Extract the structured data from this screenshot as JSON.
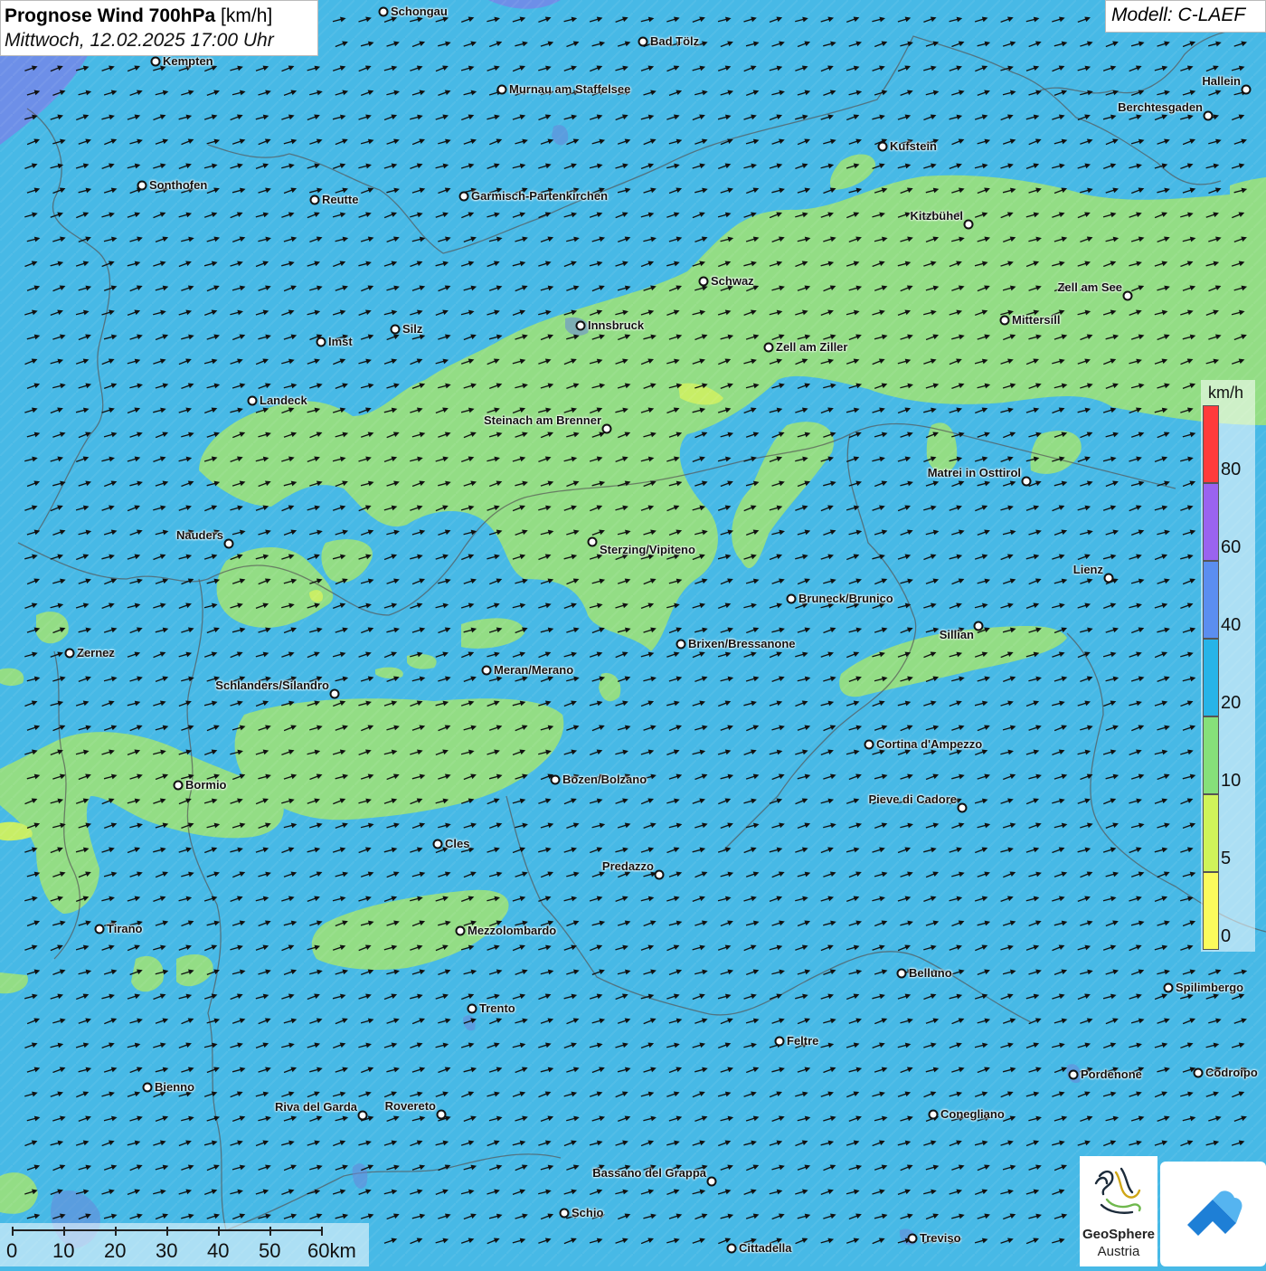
{
  "header": {
    "title_bold": "Prognose Wind 700hPa",
    "title_unit": "[km/h]",
    "datetime": "Mittwoch, 12.02.2025 17:00 Uhr"
  },
  "model": {
    "label": "Modell: C-LAEF"
  },
  "legend": {
    "unit": "km/h",
    "ticks": [
      "80",
      "60",
      "40",
      "20",
      "10",
      "5",
      "0"
    ],
    "colors": [
      "#ff3b3b",
      "#9a63ef",
      "#5b8ef0",
      "#27b4e8",
      "#86e07a",
      "#d0f45a",
      "#fbfb5c"
    ]
  },
  "scalebar": {
    "labels": [
      "0",
      "10",
      "20",
      "30",
      "40",
      "50",
      "60km"
    ]
  },
  "colors": {
    "wind_10_20": "#93dd85",
    "wind_20_40": "#47b9e6",
    "wind_5_10": "#c8ee66"
  },
  "wind": {
    "direction": "from west-southwest towards east-northeast"
  },
  "cities": [
    {
      "name": "Schongau"
    },
    {
      "name": "Bad Tölz"
    },
    {
      "name": "Kempten"
    },
    {
      "name": "Murnau am Staffelsee"
    },
    {
      "name": "Hallein"
    },
    {
      "name": "Berchtesgaden"
    },
    {
      "name": "Kufstein"
    },
    {
      "name": "Sonthofen"
    },
    {
      "name": "Reutte"
    },
    {
      "name": "Garmisch-Partenkirchen"
    },
    {
      "name": "Kitzbühel"
    },
    {
      "name": "Schwaz"
    },
    {
      "name": "Zell am See"
    },
    {
      "name": "Innsbruck"
    },
    {
      "name": "Mittersill"
    },
    {
      "name": "Silz"
    },
    {
      "name": "Imst"
    },
    {
      "name": "Zell am Ziller"
    },
    {
      "name": "Landeck"
    },
    {
      "name": "Steinach am Brenner"
    },
    {
      "name": "Matrei in Osttirol"
    },
    {
      "name": "Nauders"
    },
    {
      "name": "Sterzing/Vipiteno"
    },
    {
      "name": "Lienz"
    },
    {
      "name": "Bruneck/Brunico"
    },
    {
      "name": "Sillian"
    },
    {
      "name": "Brixen/Bressanone"
    },
    {
      "name": "Zernez"
    },
    {
      "name": "Meran/Merano"
    },
    {
      "name": "Schlanders/Silandro"
    },
    {
      "name": "Cortina d'Ampezzo"
    },
    {
      "name": "Bozen/Bolzano"
    },
    {
      "name": "Bormio"
    },
    {
      "name": "Pieve di Cadore"
    },
    {
      "name": "Cles"
    },
    {
      "name": "Predazzo"
    },
    {
      "name": "Tirano"
    },
    {
      "name": "Mezzolombardo"
    },
    {
      "name": "Belluno"
    },
    {
      "name": "Spilimbergo"
    },
    {
      "name": "Trento"
    },
    {
      "name": "Feltre"
    },
    {
      "name": "Bienno"
    },
    {
      "name": "Pordenone"
    },
    {
      "name": "Codroipo"
    },
    {
      "name": "Riva del Garda"
    },
    {
      "name": "Rovereto"
    },
    {
      "name": "Conegliano"
    },
    {
      "name": "Bassano del Grappa"
    },
    {
      "name": "Schio"
    },
    {
      "name": "Treviso"
    },
    {
      "name": "Cittadella"
    }
  ],
  "logos": {
    "geosphere_name": "GeoSphere",
    "geosphere_sub": "Austria"
  }
}
